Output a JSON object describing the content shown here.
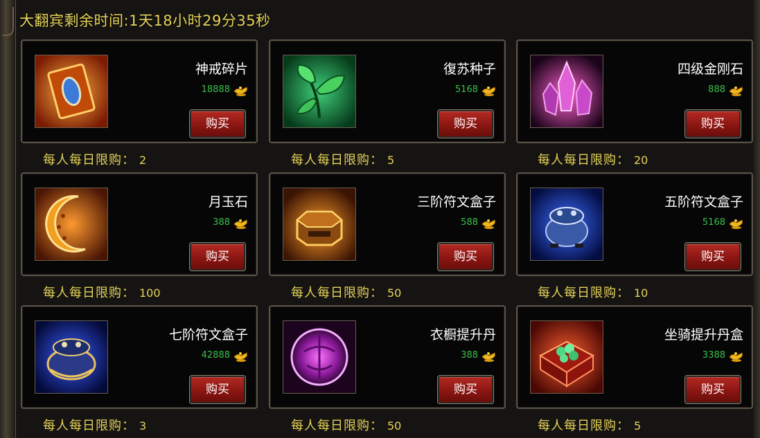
{
  "timer": {
    "label": "大翻宾剩余时间:",
    "value": "1天18小时29分35秒"
  },
  "limit_label": "每人每日限购：",
  "buy_label": "购买",
  "items": [
    {
      "name": "神戒碎片",
      "price": "18888",
      "limit": "2",
      "icon": "ring-fragment-icon",
      "color": "#e06010"
    },
    {
      "name": "復苏种子",
      "price": "5168",
      "limit": "5",
      "icon": "revival-seed-icon",
      "color": "#1f8a3a"
    },
    {
      "name": "四级金刚石",
      "price": "888",
      "limit": "20",
      "icon": "diamond-crystal-icon",
      "color": "#c0309a"
    },
    {
      "name": "月玉石",
      "price": "388",
      "limit": "100",
      "icon": "moonstone-icon",
      "color": "#d86a10"
    },
    {
      "name": "三阶符文盒子",
      "price": "588",
      "limit": "50",
      "icon": "rune-box-tier3-icon",
      "color": "#c86a12"
    },
    {
      "name": "五阶符文盒子",
      "price": "5168",
      "limit": "10",
      "icon": "rune-box-tier5-icon",
      "color": "#1e3ec8"
    },
    {
      "name": "七阶符文盒子",
      "price": "42888",
      "limit": "3",
      "icon": "rune-box-tier7-icon",
      "color": "#1e3ec8"
    },
    {
      "name": "衣橱提升丹",
      "price": "388",
      "limit": "50",
      "icon": "wardrobe-pill-icon",
      "color": "#a028b0"
    },
    {
      "name": "坐骑提升丹盒",
      "price": "3388",
      "limit": "5",
      "icon": "mount-pill-box-icon",
      "color": "#c0281c"
    }
  ]
}
